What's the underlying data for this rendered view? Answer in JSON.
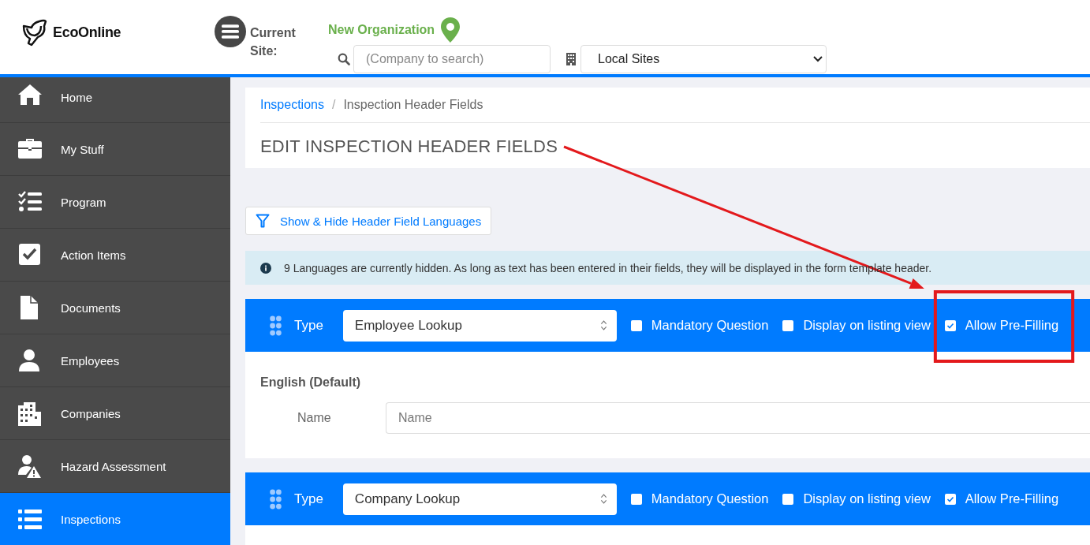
{
  "header": {
    "logo_text": "EcoOnline",
    "current_site_label": "Current Site:",
    "organization": "New Organization",
    "search": {
      "placeholder": "(Company to search)"
    },
    "site_select": "Local Sites"
  },
  "sidebar": {
    "items": [
      {
        "label": "Home",
        "selected": false
      },
      {
        "label": "My Stuff",
        "selected": false
      },
      {
        "label": "Program",
        "selected": false
      },
      {
        "label": "Action Items",
        "selected": false
      },
      {
        "label": "Documents",
        "selected": false
      },
      {
        "label": "Employees",
        "selected": false
      },
      {
        "label": "Companies",
        "selected": false
      },
      {
        "label": "Hazard Assessment",
        "selected": false
      },
      {
        "label": "Inspections",
        "selected": true
      }
    ]
  },
  "breadcrumb": {
    "separator": "/",
    "items": [
      {
        "label": "Inspections",
        "link": true
      },
      {
        "label": "Inspection Header Fields",
        "link": false
      }
    ]
  },
  "page_title": "EDIT INSPECTION HEADER FIELDS",
  "filter_button": "Show & Hide Header Field Languages",
  "info_message": "9 Languages are currently hidden. As long as text has been entered in their fields, they will be displayed in the form template header.",
  "header_fields": [
    {
      "type_label": "Type",
      "type_value": "Employee Lookup",
      "options": [
        {
          "label": "Mandatory Question",
          "checked": false,
          "highlighted": false
        },
        {
          "label": "Display on listing view",
          "checked": false,
          "highlighted": false
        },
        {
          "label": "Allow Pre-Filling",
          "checked": true,
          "highlighted": true
        }
      ],
      "language": "English (Default)",
      "name_label": "Name",
      "name_placeholder": "Name"
    },
    {
      "type_label": "Type",
      "type_value": "Company Lookup",
      "options": [
        {
          "label": "Mandatory Question",
          "checked": false,
          "highlighted": false
        },
        {
          "label": "Display on listing view",
          "checked": false,
          "highlighted": false
        },
        {
          "label": "Allow Pre-Filling",
          "checked": true,
          "highlighted": false
        }
      ]
    }
  ],
  "annotation": {
    "arrow": true
  }
}
